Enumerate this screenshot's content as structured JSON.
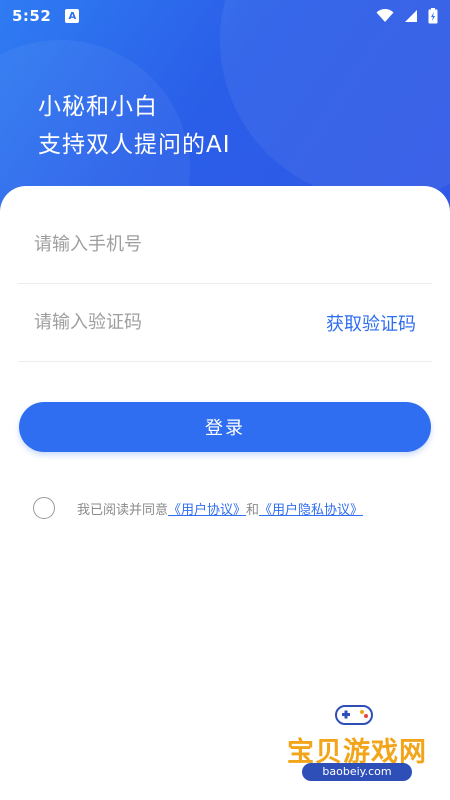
{
  "status_bar": {
    "time": "5:52",
    "notification_badge": "A",
    "icons": [
      "wifi-icon",
      "signal-icon",
      "battery-icon"
    ]
  },
  "hero": {
    "line1": "小秘和小白",
    "line2": "支持双人提问的AI"
  },
  "login": {
    "phone_placeholder": "请输入手机号",
    "code_placeholder": "请输入验证码",
    "get_code": "获取验证码",
    "submit": "登录"
  },
  "agreement": {
    "prefix": "我已阅读并同意",
    "user_agreement": "《用户协议》",
    "and": "和",
    "privacy_agreement": "《用户隐私协议》",
    "checked": false
  },
  "watermark": {
    "title": "宝贝游戏网",
    "url": "baobeiy.com"
  },
  "colors": {
    "accent": "#2f6ef0",
    "hero_start": "#2f7cf3",
    "hero_end": "#3158e6"
  }
}
